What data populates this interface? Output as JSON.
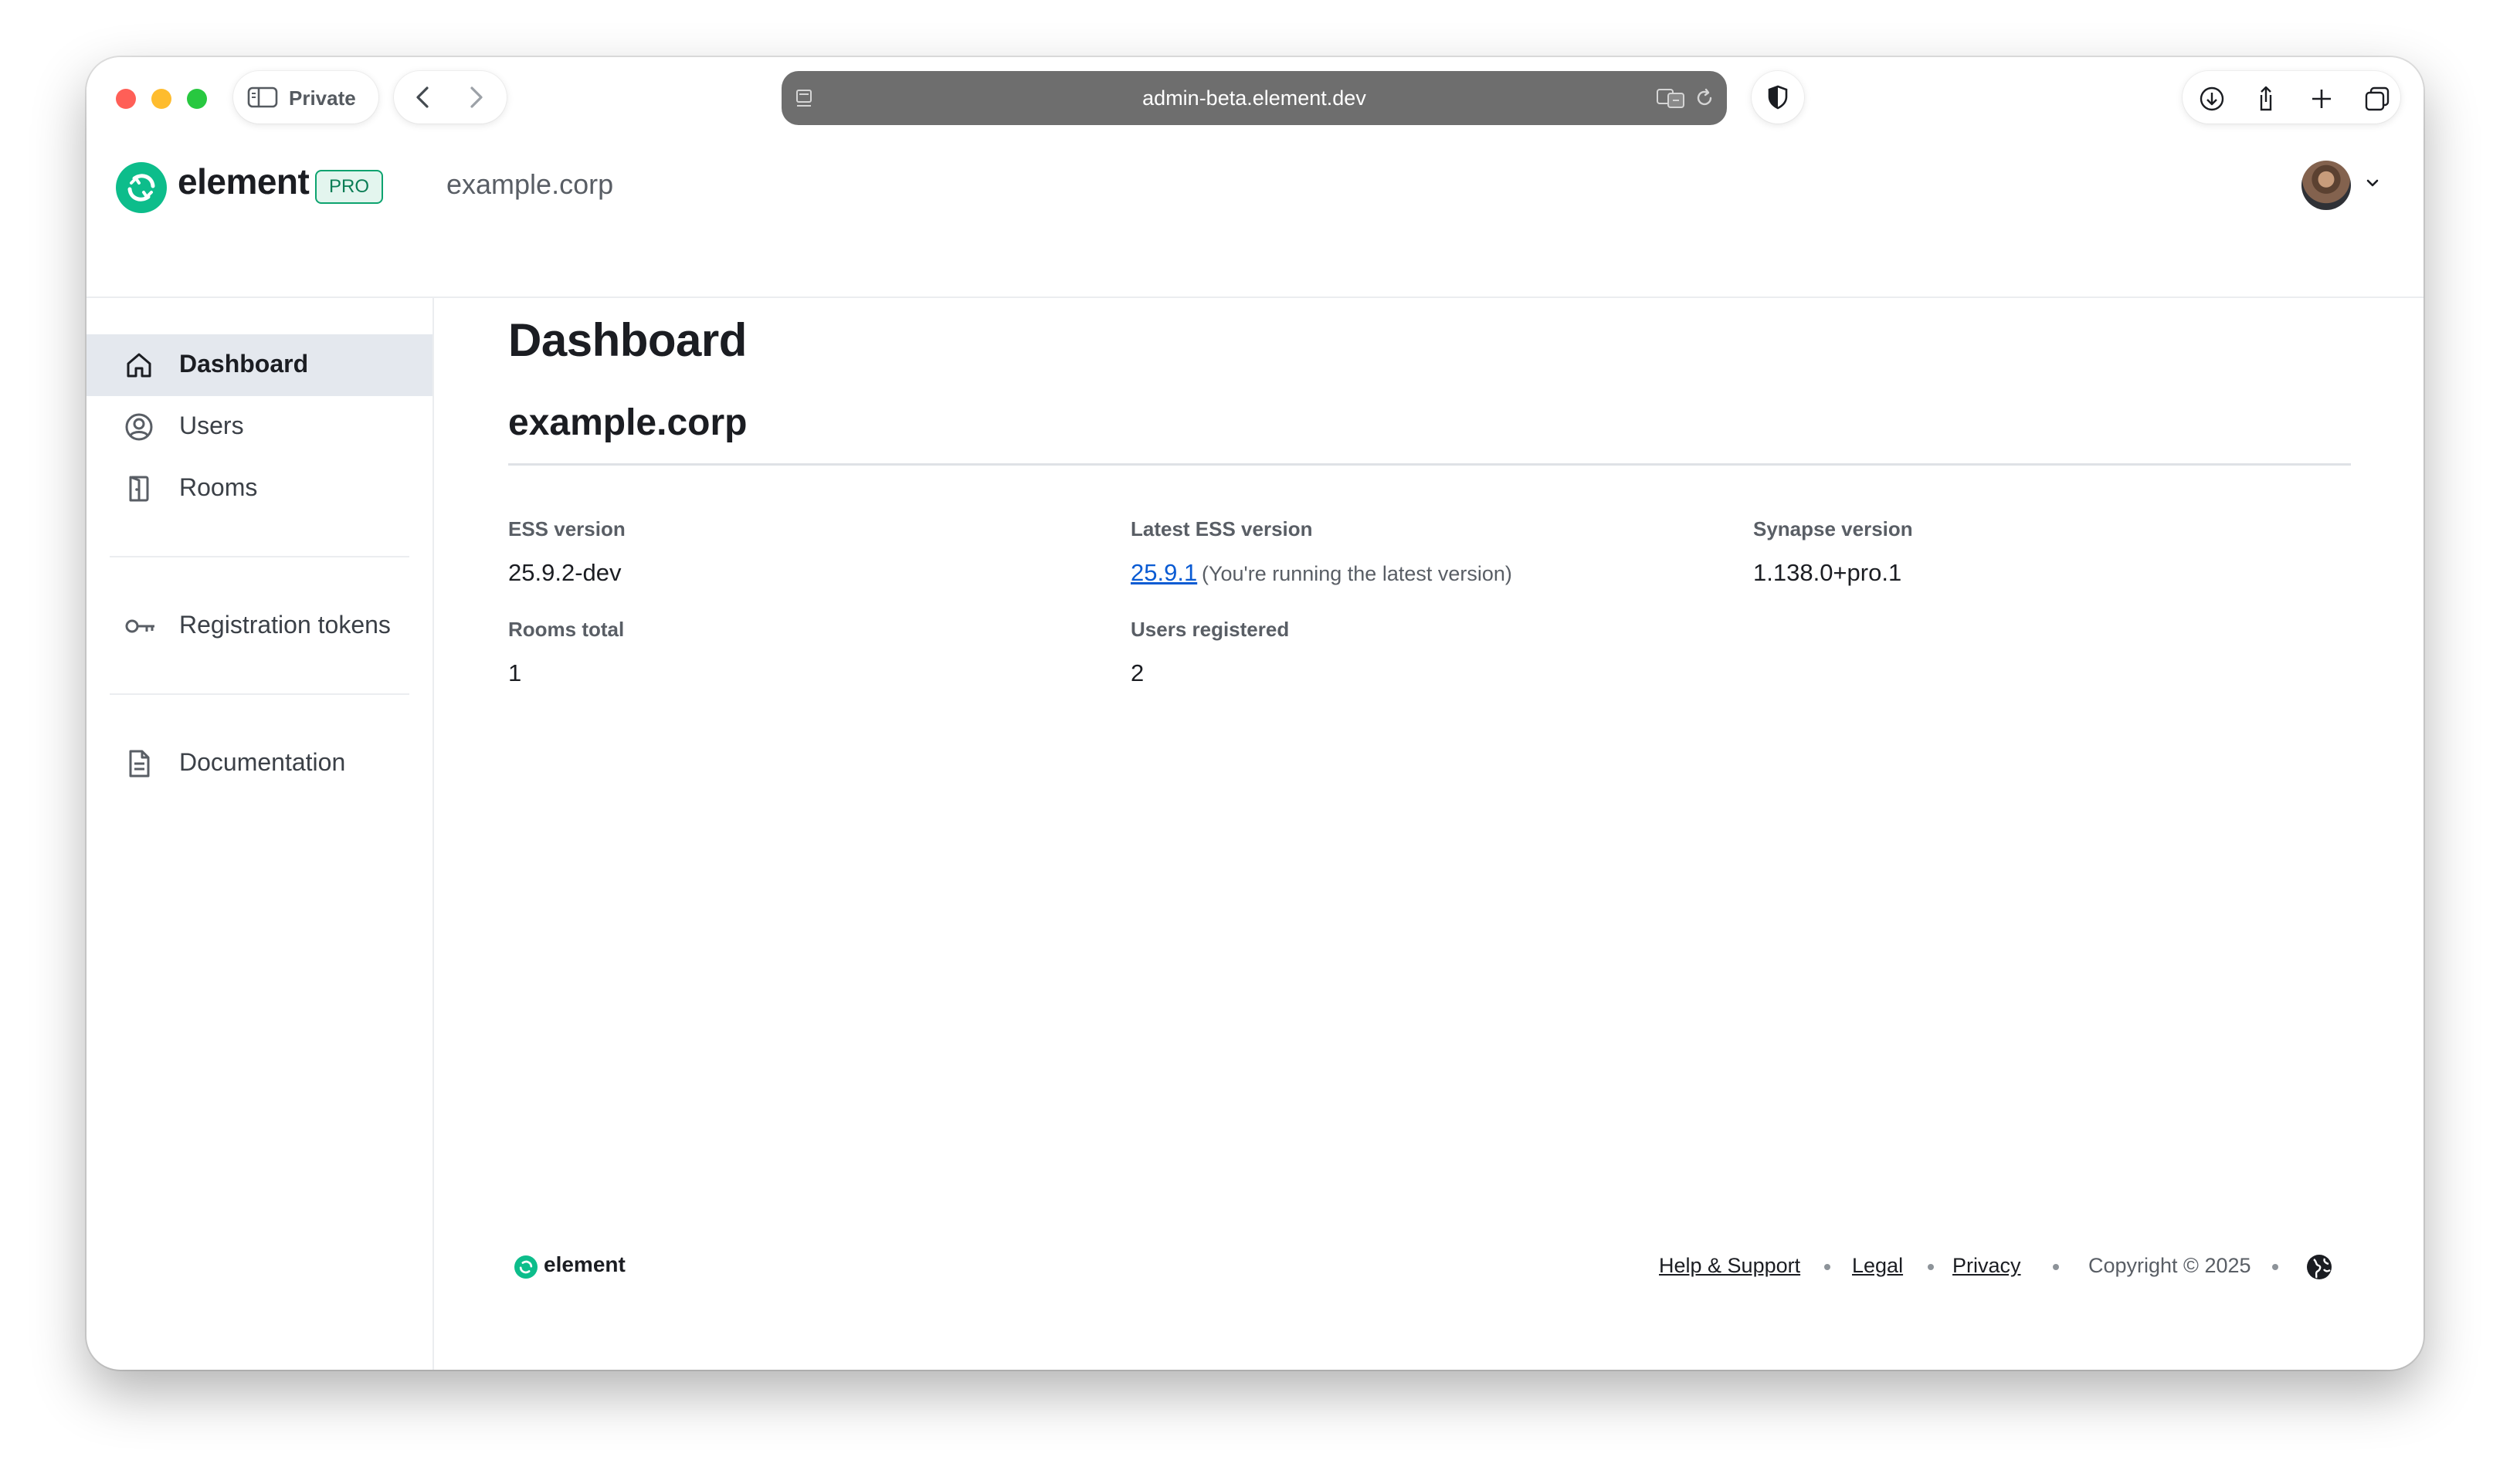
{
  "browser": {
    "private_label": "Private",
    "url": "admin-beta.element.dev"
  },
  "header": {
    "brand": "element",
    "badge": "PRO",
    "org": "example.corp"
  },
  "sidebar": {
    "items": [
      {
        "label": "Dashboard",
        "icon": "home-icon",
        "active": true
      },
      {
        "label": "Users",
        "icon": "user-circle-icon"
      },
      {
        "label": "Rooms",
        "icon": "door-icon"
      },
      {
        "label": "Registration tokens",
        "icon": "key-icon"
      },
      {
        "label": "Documentation",
        "icon": "document-icon"
      }
    ]
  },
  "main": {
    "title": "Dashboard",
    "section": "example.corp",
    "stats": {
      "ess_version": {
        "label": "ESS version",
        "value": "25.9.2-dev"
      },
      "latest_ess_version": {
        "label": "Latest ESS version",
        "value": "25.9.1",
        "note": "(You're running the latest version)"
      },
      "synapse_version": {
        "label": "Synapse version",
        "value": "1.138.0+pro.1"
      },
      "rooms_total": {
        "label": "Rooms total",
        "value": "1"
      },
      "users_registered": {
        "label": "Users registered",
        "value": "2"
      }
    }
  },
  "footer": {
    "brand": "element",
    "links": [
      "Help & Support",
      "Legal",
      "Privacy"
    ],
    "copyright": "Copyright © 2025"
  },
  "colors": {
    "brand_green": "#0dbd8b",
    "link_blue": "#0a5bd3",
    "active_nav_bg": "#e4e8ee"
  }
}
